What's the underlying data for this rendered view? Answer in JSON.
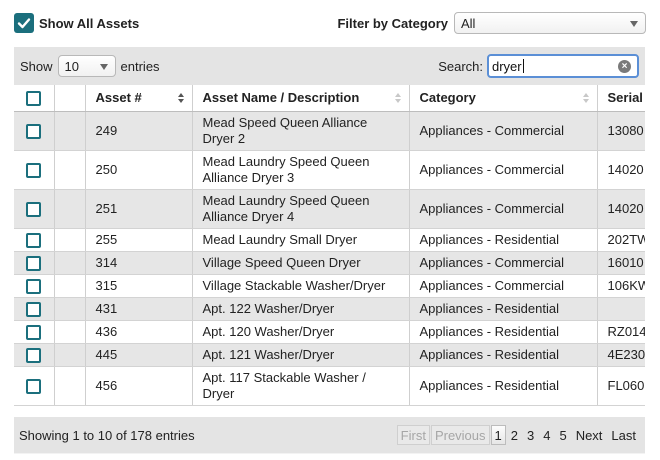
{
  "top": {
    "show_all_label": "Show All Assets",
    "show_all_checked": true,
    "filter_label": "Filter by Category",
    "filter_value": "All"
  },
  "controls": {
    "show_label": "Show",
    "entries_value": "10",
    "entries_label": "entries",
    "search_label": "Search:",
    "search_value": "dryer"
  },
  "table": {
    "columns": [
      "",
      "",
      "Asset #",
      "Asset Name / Description",
      "Category",
      "Serial #"
    ],
    "rows": [
      {
        "asset": "249",
        "name": "Mead Speed Queen Alliance Dryer 2",
        "category": "Appliances - Commercial",
        "serial": "13080"
      },
      {
        "asset": "250",
        "name": "Mead Laundry Speed Queen Alliance Dryer 3",
        "category": "Appliances - Commercial",
        "serial": "14020"
      },
      {
        "asset": "251",
        "name": "Mead Laundry Speed Queen Alliance Dryer 4",
        "category": "Appliances - Commercial",
        "serial": "14020"
      },
      {
        "asset": "255",
        "name": "Mead Laundry Small Dryer",
        "category": "Appliances - Residential",
        "serial": "202TW"
      },
      {
        "asset": "314",
        "name": "Village Speed Queen Dryer",
        "category": "Appliances - Commercial",
        "serial": "16010"
      },
      {
        "asset": "315",
        "name": "Village Stackable Washer/Dryer",
        "category": "Appliances - Commercial",
        "serial": "106KW"
      },
      {
        "asset": "431",
        "name": "Apt. 122 Washer/Dryer",
        "category": "Appliances - Residential",
        "serial": ""
      },
      {
        "asset": "436",
        "name": "Apt. 120 Washer/Dryer",
        "category": "Appliances - Residential",
        "serial": "RZ014"
      },
      {
        "asset": "445",
        "name": "Apt. 121 Washer/Dryer",
        "category": "Appliances - Residential",
        "serial": "4E230"
      },
      {
        "asset": "456",
        "name": "Apt. 117 Stackable Washer / Dryer",
        "category": "Appliances - Residential",
        "serial": "FL060"
      }
    ]
  },
  "footer": {
    "info": "Showing 1 to 10 of 178 entries",
    "first": "First",
    "previous": "Previous",
    "pages": [
      "1",
      "2",
      "3",
      "4",
      "5"
    ],
    "current_page": "1",
    "next": "Next",
    "last": "Last"
  },
  "colors": {
    "accent": "#1b6f7d",
    "panel": "#e4e4e4",
    "focus": "#5b8fd6"
  }
}
